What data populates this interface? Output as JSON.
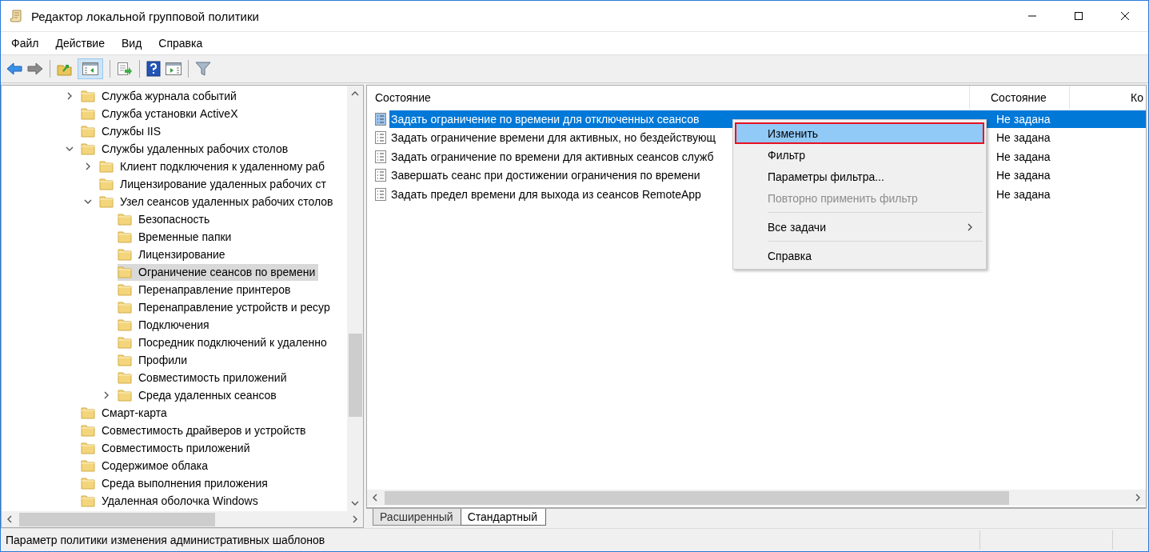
{
  "window": {
    "title": "Редактор локальной групповой политики"
  },
  "menu": [
    "Файл",
    "Действие",
    "Вид",
    "Справка"
  ],
  "toolbar": {
    "tree_toggle_on": true
  },
  "tree": [
    {
      "label": "Служба журнала событий",
      "expanded": false,
      "selected": false
    },
    {
      "label": "Служба установки ActiveX",
      "selected": false
    },
    {
      "label": "Службы IIS",
      "selected": false
    },
    {
      "label": "Службы удаленных рабочих столов",
      "expanded": true,
      "selected": false,
      "children": [
        {
          "label": "Клиент подключения к удаленному раб",
          "expanded": false,
          "selected": false
        },
        {
          "label": "Лицензирование удаленных рабочих ст",
          "selected": false
        },
        {
          "label": "Узел сеансов удаленных рабочих столов",
          "expanded": true,
          "selected": false,
          "children": [
            {
              "label": "Безопасность",
              "selected": false
            },
            {
              "label": "Временные папки",
              "selected": false
            },
            {
              "label": "Лицензирование",
              "selected": false
            },
            {
              "label": "Ограничение сеансов по времени",
              "selected": true
            },
            {
              "label": "Перенаправление принтеров",
              "selected": false
            },
            {
              "label": "Перенаправление устройств и ресур",
              "selected": false
            },
            {
              "label": "Подключения",
              "selected": false
            },
            {
              "label": "Посредник подключений к удаленно",
              "selected": false
            },
            {
              "label": "Профили",
              "selected": false
            },
            {
              "label": "Совместимость приложений",
              "selected": false
            },
            {
              "label": "Среда удаленных сеансов",
              "expanded": false,
              "selected": false
            }
          ]
        }
      ]
    },
    {
      "label": "Смарт-карта",
      "selected": false
    },
    {
      "label": "Совместимость драйверов и устройств",
      "selected": false
    },
    {
      "label": "Совместимость приложений",
      "selected": false
    },
    {
      "label": "Содержимое облака",
      "selected": false
    },
    {
      "label": "Среда выполнения приложения",
      "selected": false
    },
    {
      "label": "Удаленная оболочка Windows",
      "selected": false
    }
  ],
  "list": {
    "columns": [
      "Состояние",
      "Состояние",
      "Ко"
    ],
    "rows": [
      {
        "name": "Задать ограничение по времени для отключенных сеансов",
        "state": "Не задана",
        "selected": true
      },
      {
        "name": "Задать ограничение времени для активных, но бездействующ",
        "state": "Не задана",
        "selected": false
      },
      {
        "name": "Задать ограничение по времени для активных сеансов служб",
        "state": "Не задана",
        "selected": false
      },
      {
        "name": "Завершать сеанс при достижении ограничения по времени",
        "state": "Не задана",
        "selected": false
      },
      {
        "name": "Задать предел времени для выхода из сеансов RemoteApp",
        "state": "Не задана",
        "selected": false
      }
    ]
  },
  "context_menu": [
    {
      "kind": "item",
      "label": "Изменить",
      "selected": true,
      "disabled": false
    },
    {
      "kind": "item",
      "label": "Фильтр",
      "selected": false,
      "disabled": false
    },
    {
      "kind": "item",
      "label": "Параметры фильтра...",
      "selected": false,
      "disabled": false
    },
    {
      "kind": "item",
      "label": "Повторно применить фильтр",
      "selected": false,
      "disabled": true
    },
    {
      "kind": "separator"
    },
    {
      "kind": "submenu",
      "label": "Все задачи",
      "selected": false,
      "disabled": false
    },
    {
      "kind": "separator"
    },
    {
      "kind": "item",
      "label": "Справка",
      "selected": false,
      "disabled": false
    }
  ],
  "tabs": [
    {
      "label": "Расширенный",
      "selected": false
    },
    {
      "label": "Стандартный",
      "selected": true
    }
  ],
  "status_bar": "Параметр политики изменения административных шаблонов"
}
